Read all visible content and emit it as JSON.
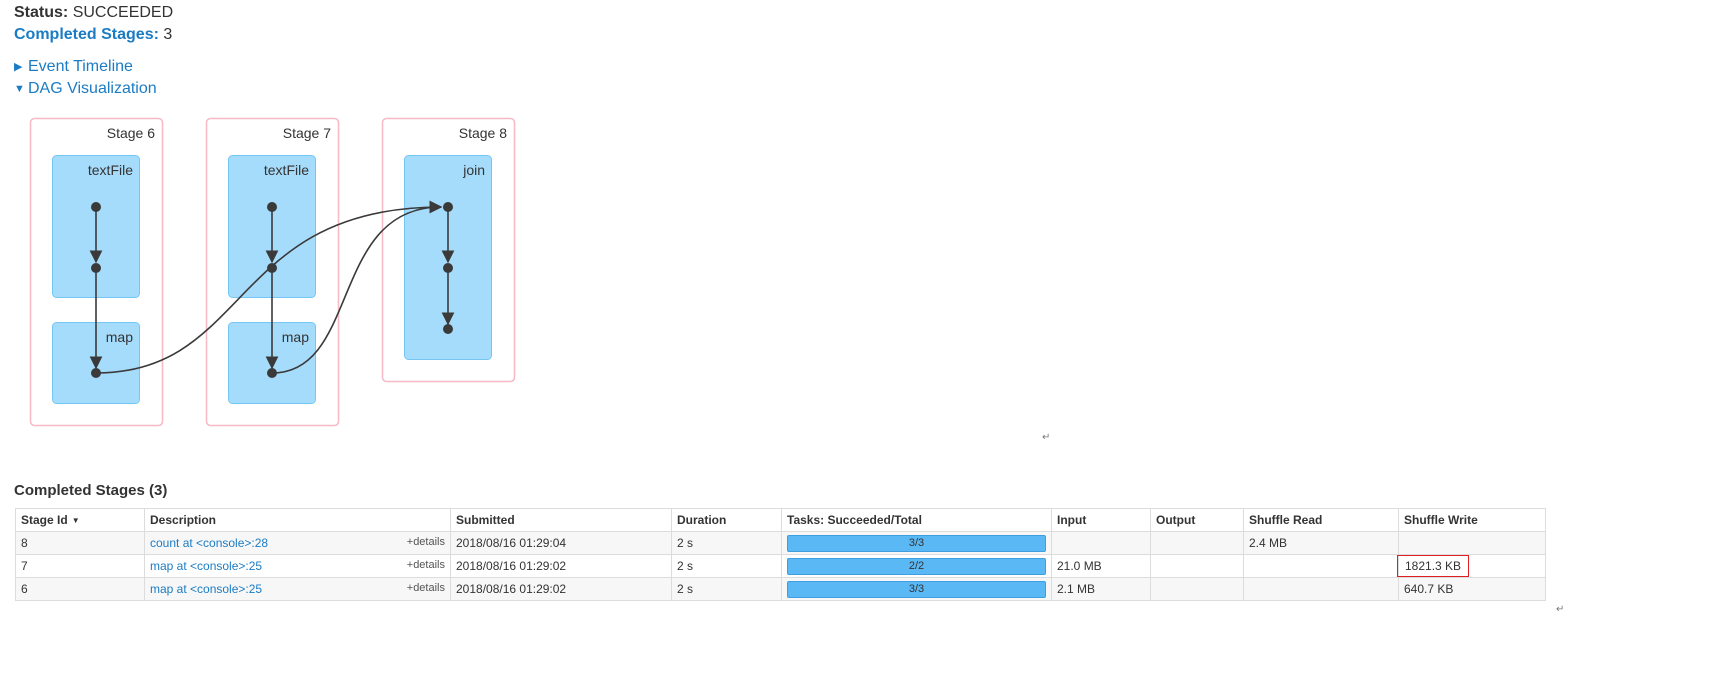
{
  "status": {
    "label": "Status:",
    "value": "SUCCEEDED"
  },
  "completed_stages": {
    "label": "Completed Stages:",
    "value": "3"
  },
  "toggles": {
    "event_timeline": "Event Timeline",
    "dag_visualization": "DAG Visualization"
  },
  "dag": {
    "stages": [
      {
        "label": "Stage 6",
        "clusters": [
          "textFile",
          "map"
        ]
      },
      {
        "label": "Stage 7",
        "clusters": [
          "textFile",
          "map"
        ]
      },
      {
        "label": "Stage 8",
        "clusters": [
          "join"
        ]
      }
    ],
    "colors": {
      "stage_border": "#f6b9c6",
      "cluster_fill": "#a6dcfb",
      "cluster_border": "#74c6f5",
      "node": "#3a3a3a"
    }
  },
  "return_mark": "↵",
  "table": {
    "title": "Completed Stages (3)",
    "headers": [
      "Stage Id",
      "Description",
      "Submitted",
      "Duration",
      "Tasks: Succeeded/Total",
      "Input",
      "Output",
      "Shuffle Read",
      "Shuffle Write"
    ],
    "details_label": "+details",
    "rows": [
      {
        "id": "8",
        "description": "count at <console>:28",
        "submitted": "2018/08/16 01:29:04",
        "duration": "2 s",
        "tasks": "3/3",
        "input": "",
        "output": "",
        "shuffle_read": "2.4 MB",
        "shuffle_write": ""
      },
      {
        "id": "7",
        "description": "map at <console>:25",
        "submitted": "2018/08/16 01:29:02",
        "duration": "2 s",
        "tasks": "2/2",
        "input": "21.0 MB",
        "output": "",
        "shuffle_read": "",
        "shuffle_write": "1821.3 KB"
      },
      {
        "id": "6",
        "description": "map at <console>:25",
        "submitted": "2018/08/16 01:29:02",
        "duration": "2 s",
        "tasks": "3/3",
        "input": "2.1 MB",
        "output": "",
        "shuffle_read": "",
        "shuffle_write": "640.7 KB"
      }
    ]
  }
}
